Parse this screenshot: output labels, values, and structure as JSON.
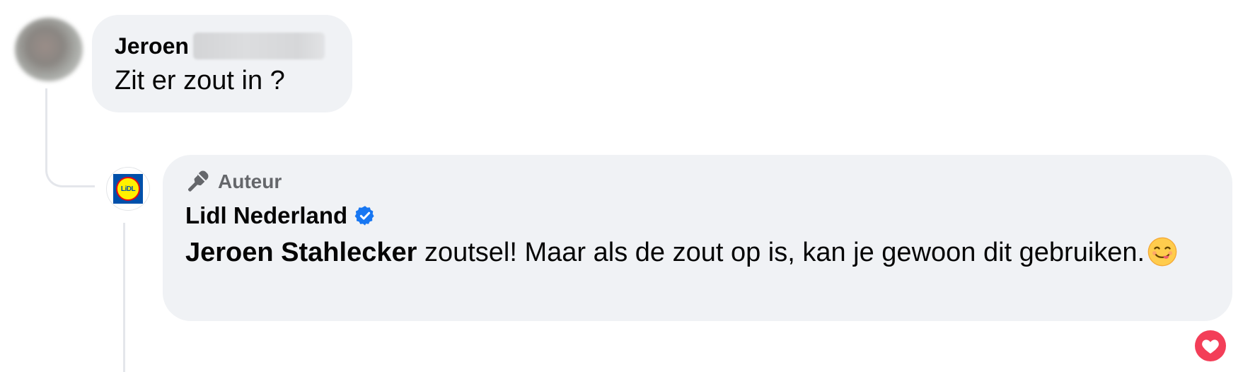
{
  "comment": {
    "author_first_name": "Jeroen",
    "text": "Zit er zout in ?"
  },
  "reply": {
    "author_badge": "Auteur",
    "page_name": "Lidl Nederland",
    "mention": "Jeroen Stahlecker",
    "text_line": " zoutsel! Maar als de zout op is, kan je gewoon dit gebruiken.",
    "emoji": "😋",
    "logo_text": "LiDL"
  },
  "reaction": {
    "type": "love",
    "icon": "heart-icon",
    "color": "#f33e58"
  },
  "colors": {
    "bubble_bg": "#f0f2f5",
    "verified_blue": "#1877f2",
    "muted_text": "#65676b"
  }
}
